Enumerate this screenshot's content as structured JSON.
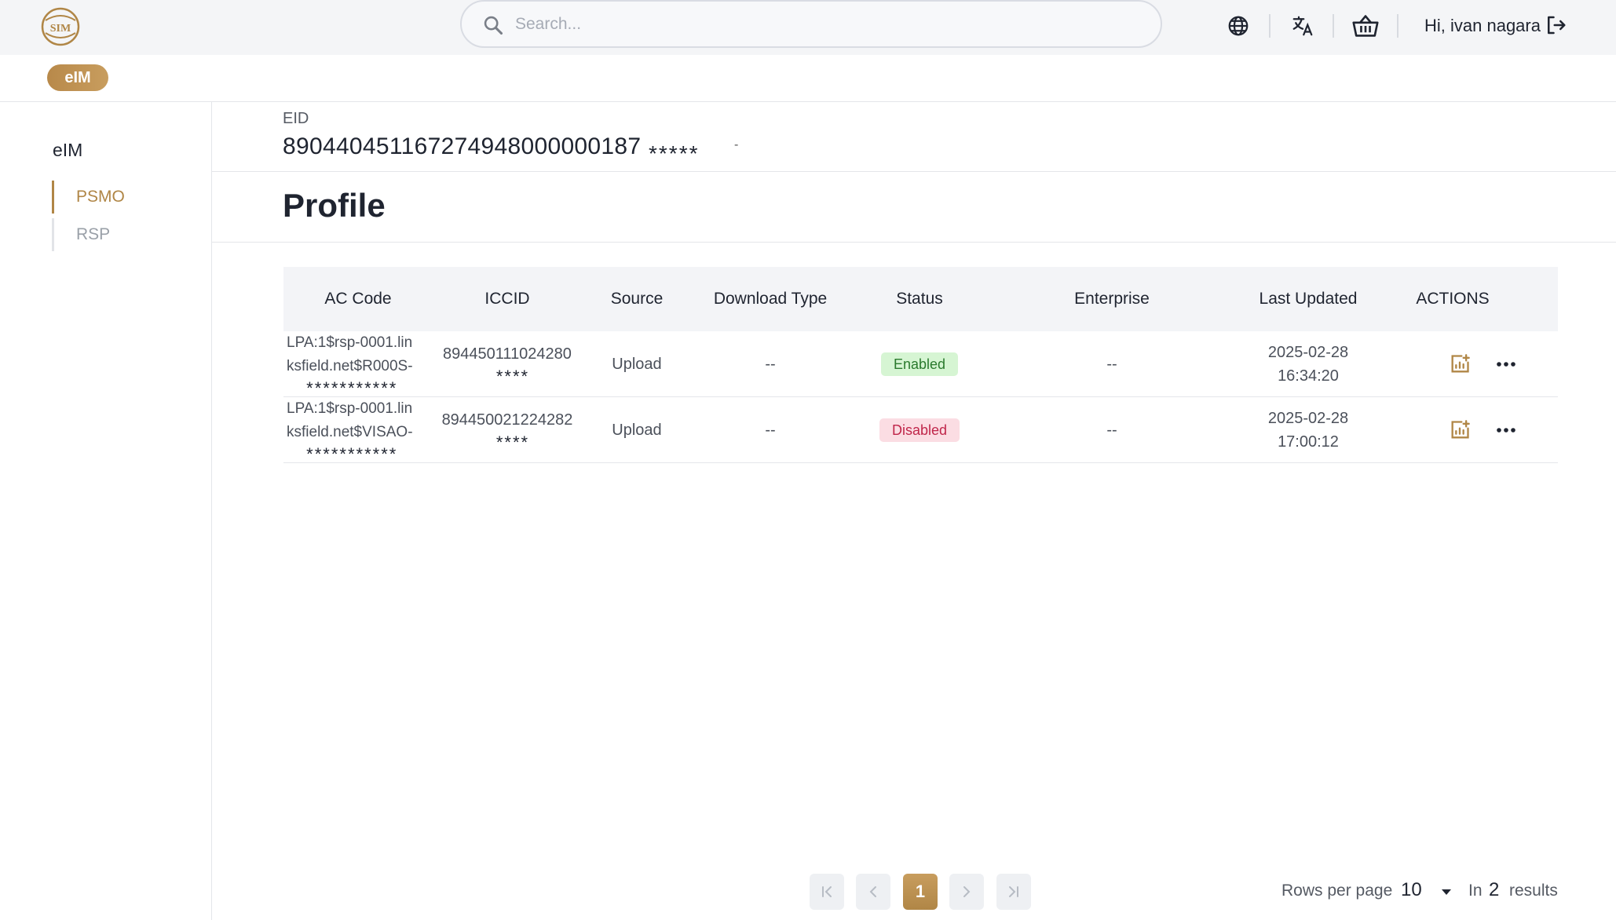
{
  "brand": {
    "logo_icon": "sim-logo-icon",
    "accent": "#b08646"
  },
  "search": {
    "placeholder": "Search..."
  },
  "header": {
    "greeting": "Hi, ivan nagara",
    "icons": [
      "globe-icon",
      "translate-icon",
      "basket-icon",
      "logout-icon"
    ]
  },
  "subbar": {
    "pill_label": "eIM"
  },
  "sidebar": {
    "title": "eIM",
    "items": [
      {
        "label": "PSMO",
        "active": true
      },
      {
        "label": "RSP",
        "active": false
      }
    ]
  },
  "main": {
    "eid_label": "EID",
    "eid_value": "8904404511672749480000001​87",
    "eid_mask": "*****",
    "eid_suffix": "-",
    "title": "Profile"
  },
  "table": {
    "columns": [
      "AC Code",
      "ICCID",
      "Source",
      "Download Type",
      "Status",
      "Enterprise",
      "Last Updated",
      "ACTIONS"
    ],
    "rows": [
      {
        "ac_line1": "LPA:1$rsp-0001.lin",
        "ac_line2": "ksfield.net$R000S-",
        "ac_mask": "***********",
        "iccid": "894450111024280",
        "iccid_mask": "****",
        "source": "Upload",
        "download_type": "--",
        "status": "Enabled",
        "enterprise": "--",
        "date": "2025-02-28",
        "time": "16:34:20"
      },
      {
        "ac_line1": "LPA:1$rsp-0001.lin",
        "ac_line2": "ksfield.net$VISAO-",
        "ac_mask": "***********",
        "iccid": "894450021224282",
        "iccid_mask": "****",
        "source": "Upload",
        "download_type": "--",
        "status": "Disabled",
        "enterprise": "--",
        "date": "2025-02-28",
        "time": "17:00:12"
      }
    ]
  },
  "pagination": {
    "current_page": "1",
    "rows_per_page_label": "Rows per page",
    "rows_per_page": "10",
    "results_prefix": "In",
    "results_count": "2",
    "results_suffix": "results"
  }
}
